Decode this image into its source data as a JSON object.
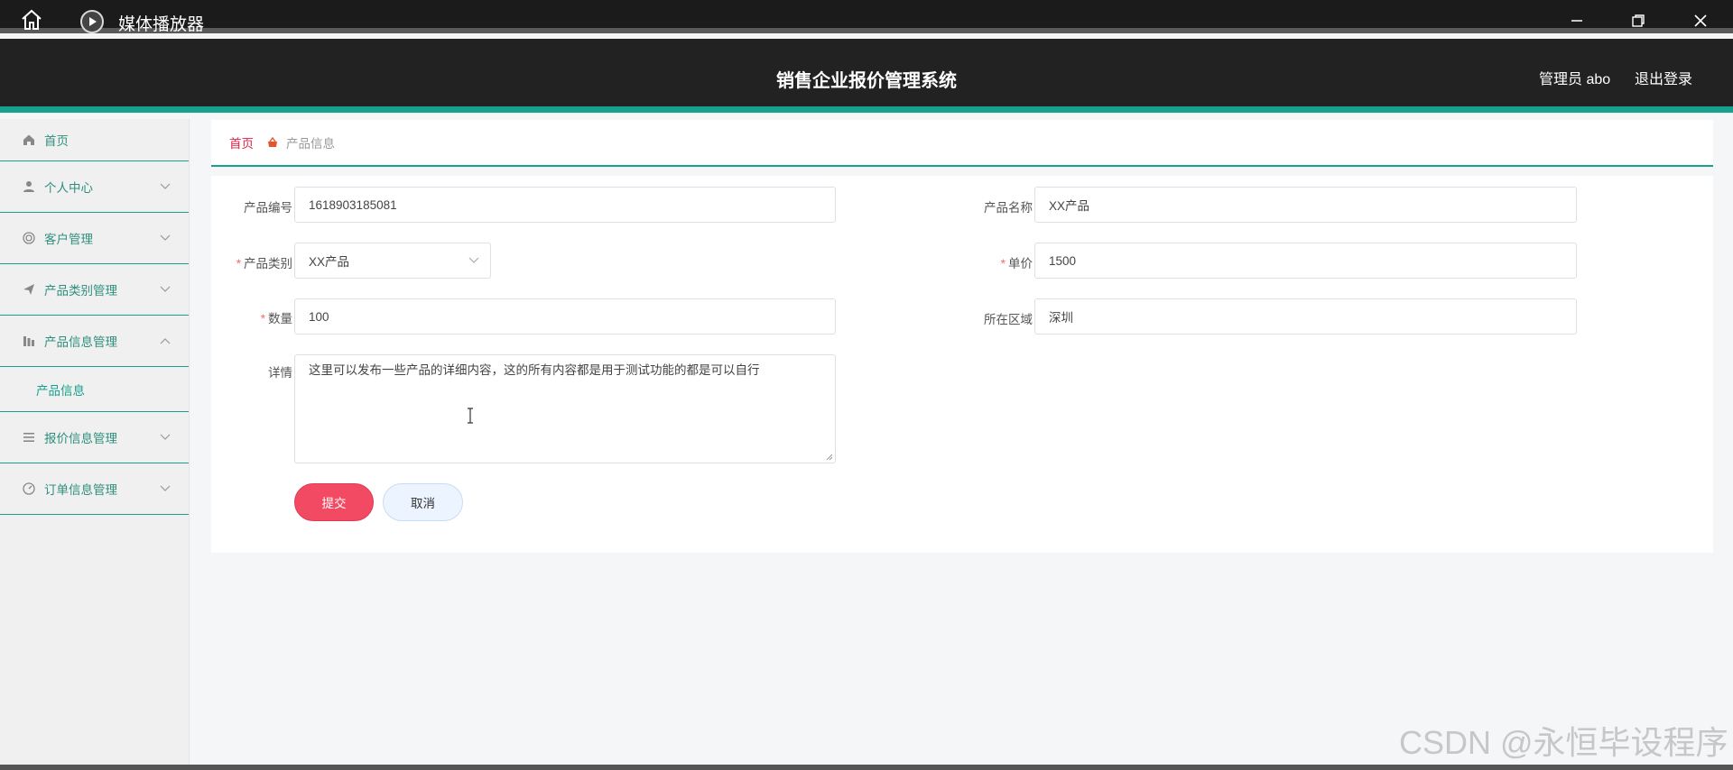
{
  "window": {
    "app_title": "媒体播放器",
    "icons": [
      "home-icon",
      "play-icon",
      "minimize-icon",
      "maximize-icon",
      "close-icon"
    ]
  },
  "header": {
    "system_title": "销售企业报价管理系统",
    "user_label": "管理员 abo",
    "logout_label": "退出登录",
    "accent_color": "#17a08c"
  },
  "sidebar": {
    "items": [
      {
        "label": "首页",
        "icon": "home-icon"
      },
      {
        "label": "个人中心",
        "icon": "user-icon"
      },
      {
        "label": "客户管理",
        "icon": "customer-icon"
      },
      {
        "label": "产品类别管理",
        "icon": "send-icon"
      },
      {
        "label": "产品信息管理",
        "icon": "chart-icon",
        "expanded": true
      },
      {
        "label": "报价信息管理",
        "icon": "list-icon"
      },
      {
        "label": "订单信息管理",
        "icon": "gauge-icon"
      }
    ],
    "submenu": {
      "label": "产品信息"
    }
  },
  "breadcrumb": {
    "home": "首页",
    "current": "产品信息"
  },
  "form": {
    "product_code": {
      "label": "产品编号",
      "value": "1618903185081"
    },
    "product_name": {
      "label": "产品名称",
      "value": "XX产品"
    },
    "product_category": {
      "label": "产品类别",
      "value": "XX产品",
      "required": true
    },
    "unit_price": {
      "label": "单价",
      "value": "1500",
      "required": true
    },
    "quantity": {
      "label": "数量",
      "value": "100",
      "required": true
    },
    "region": {
      "label": "所在区域",
      "value": "深圳"
    },
    "details": {
      "label": "详情",
      "value": "这里可以发布一些产品的详细内容，这的所有内容都是用于测试功能的都是可以自行"
    },
    "required_mark": "*",
    "submit_label": "提交",
    "cancel_label": "取消"
  },
  "watermark": "CSDN @永恒毕设程序"
}
